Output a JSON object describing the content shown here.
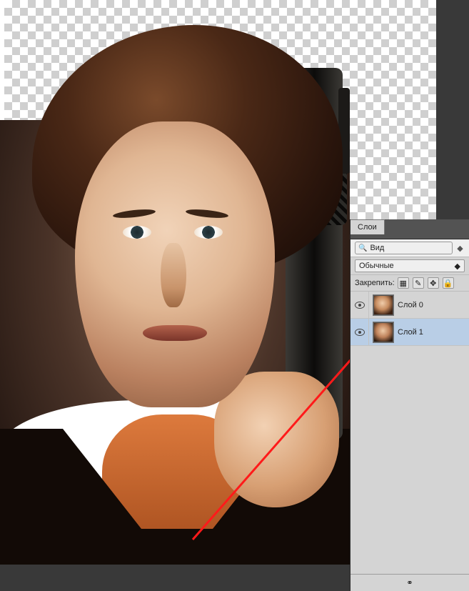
{
  "panel": {
    "tab_label": "Слои",
    "search_placeholder": "Вид",
    "blend_mode": "Обычные",
    "lock_label": "Закрепить:"
  },
  "layers": [
    {
      "name": "Слой 0",
      "selected": false
    },
    {
      "name": "Слой 1",
      "selected": true
    }
  ]
}
